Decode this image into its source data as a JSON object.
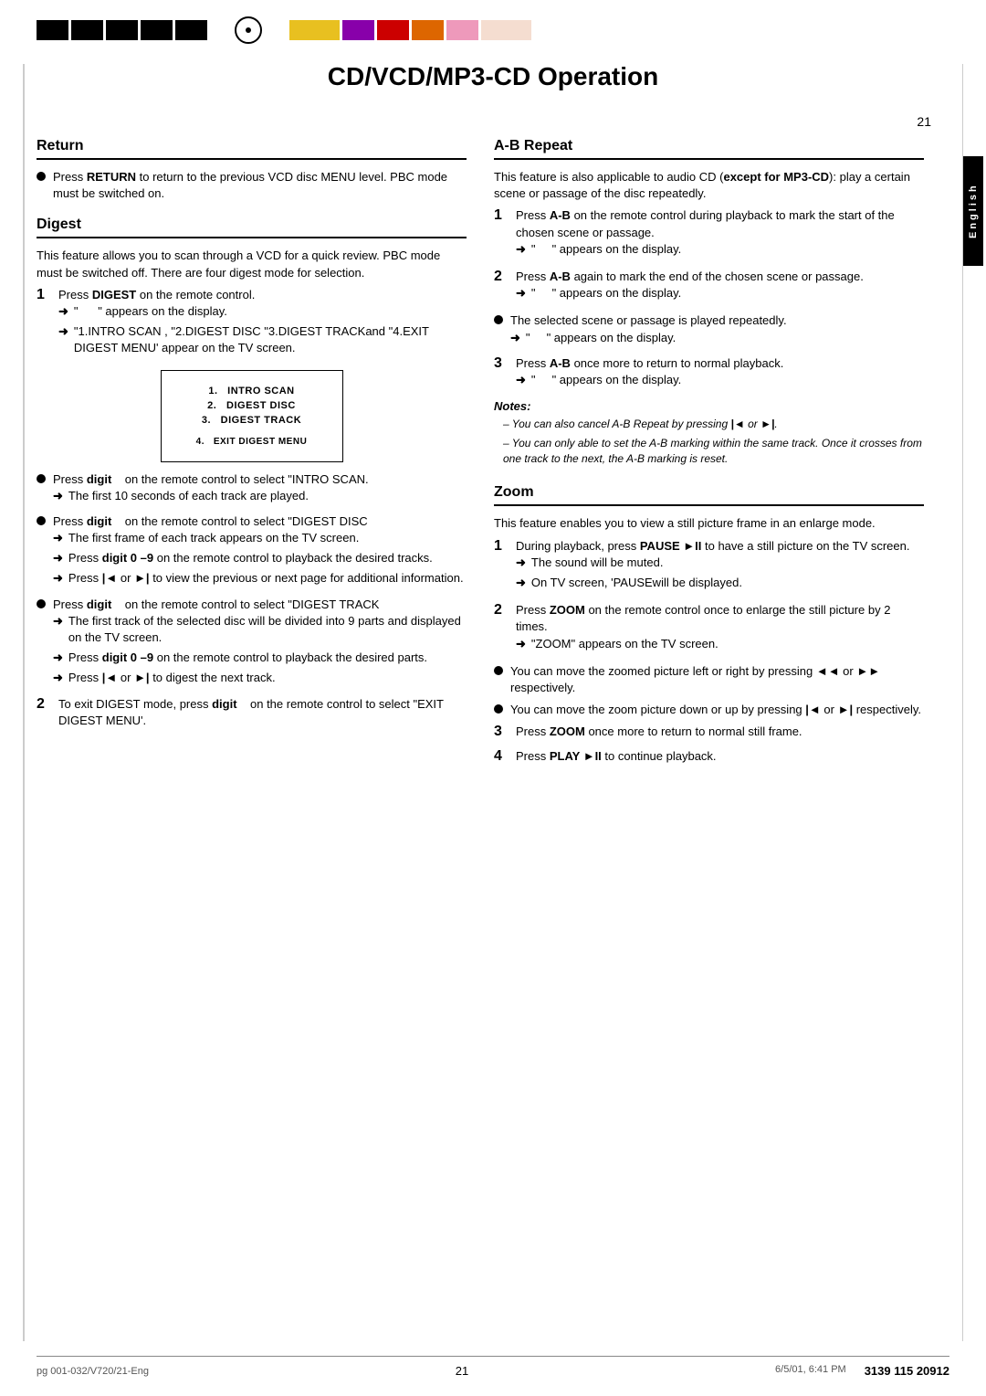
{
  "page": {
    "title": "CD/VCD/MP3-CD Operation",
    "page_number": "21",
    "footer_left": "pg 001-032/V720/21-Eng",
    "footer_center": "21",
    "footer_date": "6/5/01, 6:41 PM",
    "footer_code": "3139 115 20912",
    "sidebar_label": "English"
  },
  "colors": {
    "left_bars": [
      "#000000",
      "#000000",
      "#000000",
      "#000000",
      "#000000"
    ],
    "right_bars": [
      "#ffcc00",
      "#aa00cc",
      "#cc0000",
      "#ee6600",
      "#ff99cc",
      "#ffddcc"
    ],
    "black": "#000000"
  },
  "sections": {
    "return": {
      "title": "Return",
      "content": "Press RETURN to return to the previous VCD disc MENU level. PBC mode must be switched on."
    },
    "digest": {
      "title": "Digest",
      "intro": "This feature allows you to scan through a VCD for a quick review. PBC mode must be switched off. There are four digest mode for selection.",
      "step1": {
        "text": "Press DIGEST on the remote control.",
        "arrow1": "\" \" appears on the display.",
        "arrow2": "\"1. INTRO SCAN , \"2.DIGEST DISC \"3.DIGEST TRACKand \"4.EXIT DIGEST MENU' appear on the TV screen."
      },
      "menu": {
        "items": [
          "1.  INTRO SCAN",
          "2.  DIGEST DISC",
          "3.  DIGEST TRACK",
          "4.  EXIT DIGEST MENU"
        ]
      },
      "bullet1": {
        "text": "Press digit    on the remote control to select \"INTRO SCAN.",
        "arrow": "The first 10 seconds of each track are played."
      },
      "bullet2": {
        "text": "Press digit    on the remote control to select \"DIGEST DISC",
        "arrow1": "The first frame of each track appears on the TV screen.",
        "arrow2": "Press digit 0 –9 on the remote control to playback the desired tracks.",
        "arrow3": "Press |◄ or ►| to view the previous or next page for additional information."
      },
      "bullet3": {
        "text": "Press digit    on the remote control to select \"DIGEST TRACK",
        "arrow1": "The first track of the selected disc will be divided into 9 parts and displayed on the TV screen.",
        "arrow2": "Press digit 0 –9 on the remote control to playback the desired parts.",
        "arrow3": "Press |◄ or ►| to digest the next track."
      },
      "step2": {
        "text": "To exit DIGEST mode, press digit    on the remote control to select \"EXIT DIGEST MENU'."
      }
    },
    "ab_repeat": {
      "title": "A-B Repeat",
      "intro": "This feature is also applicable to audio CD (except for MP3-CD): play a certain scene or passage of the disc repeatedly.",
      "step1": {
        "text": "Press A-B on the remote control during playback to mark the start of the chosen scene or passage.",
        "arrow": "\" \" appears on the display."
      },
      "step2": {
        "text": "Press A-B again to mark the end of the chosen scene or passage.",
        "arrow": "\" \" appears on the display."
      },
      "bullet1": {
        "text": "The selected scene or passage is played repeatedly.",
        "arrow": "\" \" appears on the display."
      },
      "step3": {
        "text": "Press A-B once more to return to normal playback.",
        "arrow": "\" \" appears on the display."
      },
      "notes": {
        "title": "Notes:",
        "note1": "– You can also cancel A-B Repeat by pressing |◄ or ►|.",
        "note2": "– You can only able to set the A-B marking within the same track. Once it crosses from one track to the next, the A-B marking is reset."
      }
    },
    "zoom": {
      "title": "Zoom",
      "intro": "This feature enables you to view a still picture frame in an enlarge mode.",
      "step1": {
        "text": "During playback, press PAUSE ►II to have a still picture on the TV screen.",
        "arrow1": "The sound will be muted.",
        "arrow2": "On TV screen, 'PAUSEwill be displayed."
      },
      "step2": {
        "text": "Press ZOOM on the remote control once to enlarge the still picture by 2 times.",
        "arrow": "\"ZOOM\" appears on the TV screen."
      },
      "bullet1": "You can move the zoomed picture left or right by pressing ◄◄ or ►► respectively.",
      "bullet2": "You can move the zoom picture down or up by pressing |◄ or ►| respectively.",
      "step3": "Press ZOOM once more to return to normal still frame.",
      "step4": "Press PLAY ►II to continue playback."
    }
  }
}
